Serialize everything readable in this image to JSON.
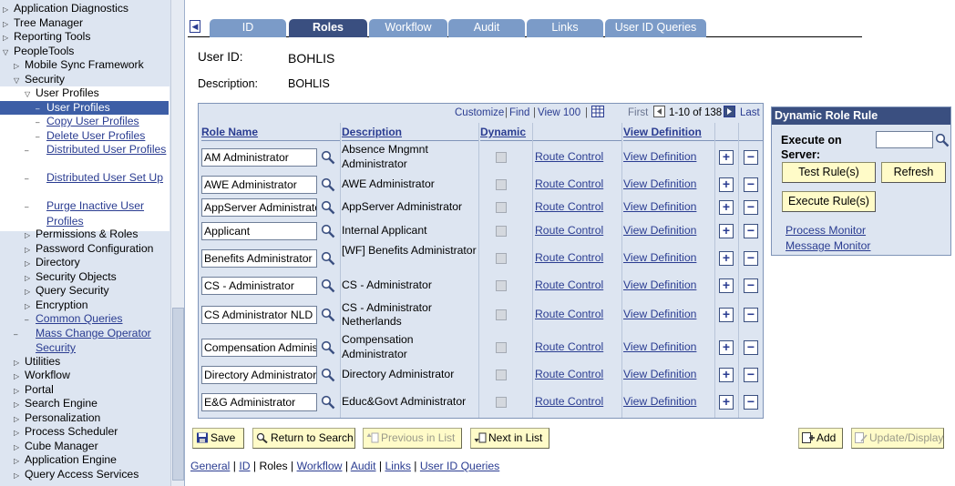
{
  "nav": {
    "items": [
      {
        "label": "Application Diagnostics",
        "type": "closed",
        "level": 0
      },
      {
        "label": "Tree Manager",
        "type": "closed",
        "level": 0
      },
      {
        "label": "Reporting Tools",
        "type": "closed",
        "level": 0
      },
      {
        "label": "PeopleTools",
        "type": "open",
        "level": 0
      },
      {
        "label": "Mobile Sync Framework",
        "type": "closed",
        "level": 1
      },
      {
        "label": "Security",
        "type": "open",
        "level": 1
      },
      {
        "label": "User Profiles",
        "type": "open",
        "level": 2
      },
      {
        "label": "User Profiles",
        "type": "leaf-selected",
        "level": 3
      },
      {
        "label": "Copy User Profiles",
        "type": "leaf",
        "level": 3
      },
      {
        "label": "Delete User Profiles",
        "type": "leaf",
        "level": 3
      },
      {
        "label": "Distributed User Profiles",
        "type": "leaf",
        "level": 3
      },
      {
        "label": "Distributed User Set Up",
        "type": "leaf",
        "level": 3
      },
      {
        "label": "Purge Inactive User Profiles",
        "type": "leaf",
        "level": 3
      },
      {
        "label": "Permissions & Roles",
        "type": "closed",
        "level": 2
      },
      {
        "label": "Password Configuration",
        "type": "closed",
        "level": 2
      },
      {
        "label": "Directory",
        "type": "closed",
        "level": 2
      },
      {
        "label": "Security Objects",
        "type": "closed",
        "level": 2
      },
      {
        "label": "Query Security",
        "type": "closed",
        "level": 2
      },
      {
        "label": "Encryption",
        "type": "closed",
        "level": 2
      },
      {
        "label": "Common Queries",
        "type": "leaf",
        "level": 2
      },
      {
        "label": "Mass Change Operator Security",
        "type": "leaf",
        "level": 2
      },
      {
        "label": "Utilities",
        "type": "closed",
        "level": 1
      },
      {
        "label": "Workflow",
        "type": "closed",
        "level": 1
      },
      {
        "label": "Portal",
        "type": "closed",
        "level": 1
      },
      {
        "label": "Search Engine",
        "type": "closed",
        "level": 1
      },
      {
        "label": "Personalization",
        "type": "closed",
        "level": 1
      },
      {
        "label": "Process Scheduler",
        "type": "closed",
        "level": 1
      },
      {
        "label": "Cube Manager",
        "type": "closed",
        "level": 1
      },
      {
        "label": "Application Engine",
        "type": "closed",
        "level": 1
      },
      {
        "label": "Query Access Services",
        "type": "closed",
        "level": 1
      }
    ]
  },
  "tabs": [
    {
      "label": "ID",
      "active": false
    },
    {
      "label": "Roles",
      "active": true
    },
    {
      "label": "Workflow",
      "active": false
    },
    {
      "label": "Audit",
      "active": false
    },
    {
      "label": "Links",
      "active": false
    },
    {
      "label": "User ID Queries",
      "active": false
    }
  ],
  "header": {
    "user_id_label": "User ID:",
    "user_id_value": "BOHLIS",
    "description_label": "Description:",
    "description_value": "BOHLIS"
  },
  "grid": {
    "customize": "Customize",
    "find": "Find",
    "view_all": "View 100",
    "first": "First",
    "range": "1-10 of 138",
    "last": "Last",
    "columns": {
      "role_name": "Role Name",
      "description": "Description",
      "dynamic": "Dynamic",
      "view_definition": "View Definition"
    },
    "rows": [
      {
        "role": "AM Administrator",
        "desc": "Absence Mngmnt Administrator",
        "route": "Route Control",
        "view": "View Definition"
      },
      {
        "role": "AWE Administrator",
        "desc": "AWE Administrator",
        "route": "Route Control",
        "view": "View Definition"
      },
      {
        "role": "AppServer Administrator",
        "desc": "AppServer Administrator",
        "route": "Route Control",
        "view": "View Definition"
      },
      {
        "role": "Applicant",
        "desc": "Internal Applicant",
        "route": "Route Control",
        "view": "View Definition"
      },
      {
        "role": "Benefits Administrator",
        "desc": "[WF] Benefits Administrator",
        "route": "Route Control",
        "view": "View Definition"
      },
      {
        "role": "CS - Administrator",
        "desc": "CS - Administrator",
        "route": "Route Control",
        "view": "View Definition"
      },
      {
        "role": "CS Administrator NLD",
        "desc": "CS - Administrator Netherlands",
        "route": "Route Control",
        "view": "View Definition"
      },
      {
        "role": "Compensation Administrator",
        "desc": "Compensation Administrator",
        "route": "Route Control",
        "view": "View Definition"
      },
      {
        "role": "Directory Administrator",
        "desc": "Directory Administrator",
        "route": "Route Control",
        "view": "View Definition"
      },
      {
        "role": "E&G Administrator",
        "desc": "Educ&Govt Administrator",
        "route": "Route Control",
        "view": "View Definition"
      }
    ]
  },
  "dynamic_panel": {
    "title": "Dynamic Role Rule",
    "execute_on_server_label": "Execute on Server:",
    "server_value": "",
    "test_rules": "Test Rule(s)",
    "refresh": "Refresh",
    "execute_rules": "Execute Rule(s)",
    "process_monitor": "Process Monitor",
    "message_monitor": "Message Monitor"
  },
  "toolbar": {
    "save": "Save",
    "return_to_search": "Return to Search",
    "previous_in_list": "Previous in List",
    "next_in_list": "Next in List",
    "add": "Add",
    "update_display": "Update/Display"
  },
  "footer_links": [
    {
      "label": "General",
      "current": false
    },
    {
      "label": "ID",
      "current": false
    },
    {
      "label": "Roles",
      "current": true
    },
    {
      "label": "Workflow",
      "current": false
    },
    {
      "label": "Audit",
      "current": false
    },
    {
      "label": "Links",
      "current": false
    },
    {
      "label": "User ID Queries",
      "current": false
    }
  ],
  "colors": {
    "nav_bg": "#dde5f1",
    "link": "#2a3c91",
    "tab": "#7b9bc8",
    "tab_active": "#3a4f80",
    "button_bg": "#fffbc8"
  }
}
